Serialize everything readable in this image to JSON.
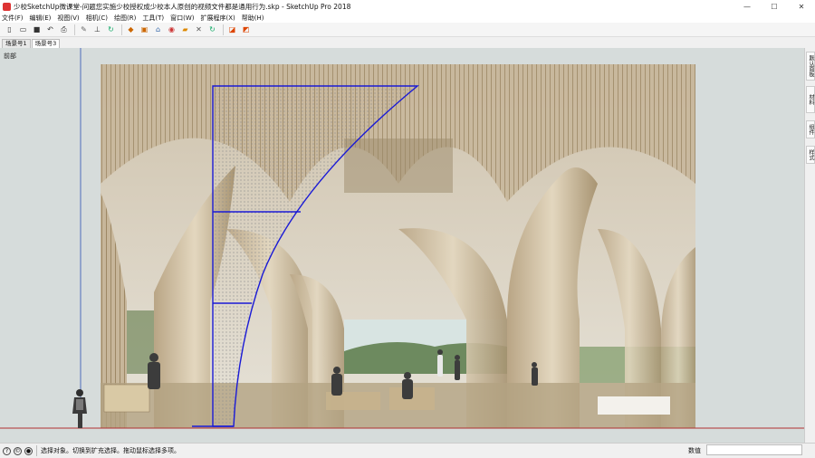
{
  "window": {
    "title": "少校SketchUp微课堂-问题您实施少校授权成少校本人原创的视频文件都是通用行为.skp - SketchUp Pro 2018",
    "minimize": "—",
    "maximize": "☐",
    "close": "✕"
  },
  "menu": [
    "文件(F)",
    "编辑(E)",
    "视图(V)",
    "相机(C)",
    "绘图(R)",
    "工具(T)",
    "窗口(W)",
    "扩展程序(X)",
    "帮助(H)"
  ],
  "toolbar": {
    "icons": [
      "new-icon",
      "open-icon",
      "save-icon",
      "undo-icon",
      "print-icon",
      "pencil-icon",
      "tape-icon",
      "rotate-icon",
      "paint-icon",
      "component-icon",
      "warehouse-icon",
      "extension-icon",
      "camera-icon",
      "tools-icon",
      "refresh-icon",
      "section-icon",
      "section-fill-icon"
    ]
  },
  "scenes": [
    "场景号1",
    "场景号3"
  ],
  "viewport": {
    "label": "前部"
  },
  "tray": {
    "tabs": [
      "默认面板",
      "材料",
      "组件",
      "样式"
    ]
  },
  "status": {
    "message": "选择对象。切换到扩充选择。拖动鼠标选择多项。",
    "measure_label": "数值",
    "measure_value": ""
  },
  "colors": {
    "accent": "#1a1ad6",
    "ground": "#b03030"
  }
}
